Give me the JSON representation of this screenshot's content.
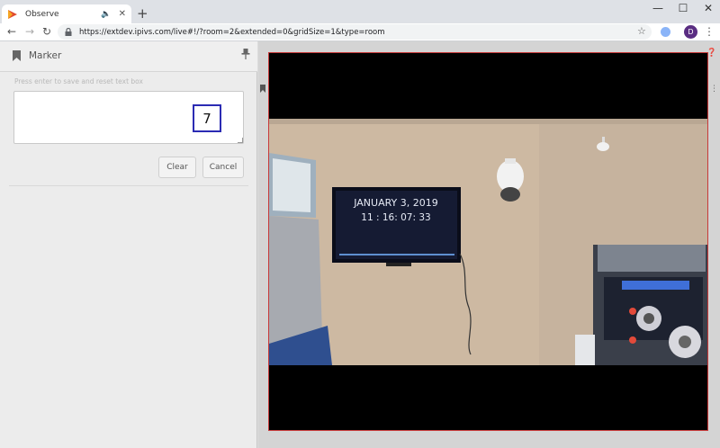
{
  "browser": {
    "tab": {
      "title": "Observe",
      "favicon": "observe-play-icon"
    },
    "new_tab_label": "+",
    "url": "https://extdev.ipivs.com/live#!/?room=2&extended=0&gridSize=1&type=room",
    "profile_initial": "D"
  },
  "marker": {
    "title": "Marker",
    "hint": "Press enter to save and reset text box",
    "text_value": "",
    "counter": "7",
    "buttons": {
      "clear": "Clear",
      "cancel": "Cancel"
    }
  },
  "camera": {
    "tv_date": "JANUARY 3, 2019",
    "tv_time": "11 : 16: 07: 33"
  },
  "colors": {
    "video_border": "#c83a3a",
    "counter_border": "#2b2bb3",
    "profile": "#5a2d82"
  }
}
